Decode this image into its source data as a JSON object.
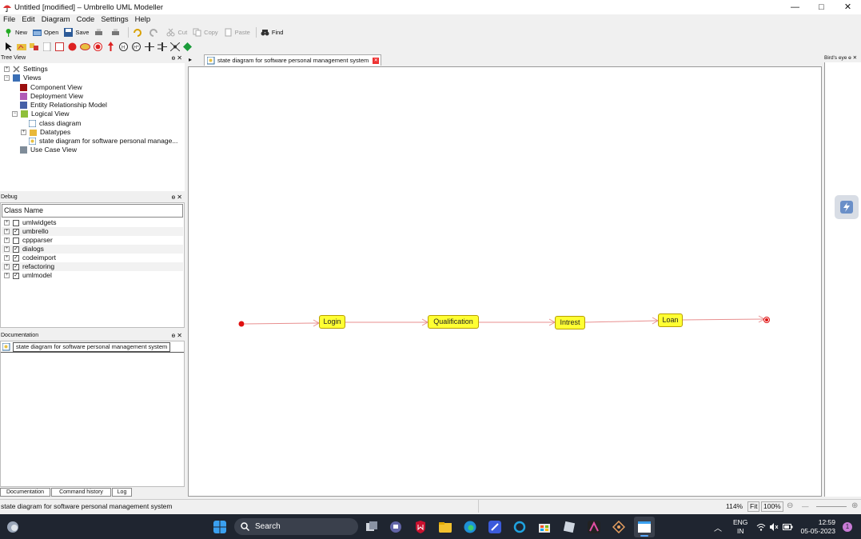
{
  "window": {
    "title": "Untitled [modified] – Umbrello UML Modeller",
    "controls": [
      "—",
      "□",
      "✕"
    ]
  },
  "menu": [
    "File",
    "Edit",
    "Diagram",
    "Code",
    "Settings",
    "Help"
  ],
  "toolbar": {
    "new": "New",
    "open": "Open",
    "save": "Save",
    "cut": "Cut",
    "copy": "Copy",
    "paste": "Paste",
    "find": "Find"
  },
  "tree_view": {
    "header": "Tree View",
    "items": [
      {
        "label": "Settings"
      },
      {
        "label": "Views"
      },
      {
        "label": "Component View"
      },
      {
        "label": "Deployment View"
      },
      {
        "label": "Entity Relationship Model"
      },
      {
        "label": "Logical View"
      },
      {
        "label": "class diagram"
      },
      {
        "label": "Datatypes"
      },
      {
        "label": "state diagram for software personal manage..."
      },
      {
        "label": "Use Case View"
      }
    ]
  },
  "debug": {
    "header": "Debug",
    "column": "Class Name",
    "rows": [
      {
        "label": "umlwidgets",
        "checked": false
      },
      {
        "label": "umbrello",
        "checked": true
      },
      {
        "label": "cppparser",
        "checked": false
      },
      {
        "label": "dialogs",
        "checked": true
      },
      {
        "label": "codeimport",
        "checked": true
      },
      {
        "label": "refactoring",
        "checked": true
      },
      {
        "label": "umlmodel",
        "checked": true
      }
    ]
  },
  "documentation": {
    "header": "Documentation",
    "field": "state diagram for software personal management system"
  },
  "bottom_tabs": [
    "Documentation",
    "Command history",
    "Log"
  ],
  "diagram_tab": "state diagram for software personal management system",
  "diagram": {
    "states": [
      "Login",
      "Qualification",
      "Intrest",
      "Loan"
    ]
  },
  "birdseye": {
    "header": "Bird's eye"
  },
  "status": {
    "text": "state diagram for software personal management system",
    "zoom": "114%",
    "fit": "Fit",
    "hundred": "100%"
  },
  "taskbar": {
    "search": "Search",
    "lang1": "ENG",
    "lang2": "IN",
    "time": "12:59",
    "date": "05-05-2023",
    "notif": "1"
  },
  "colors": {
    "state_fill": "#ffff33",
    "transition": "#e88f8f",
    "taskbar": "#1f2530"
  }
}
